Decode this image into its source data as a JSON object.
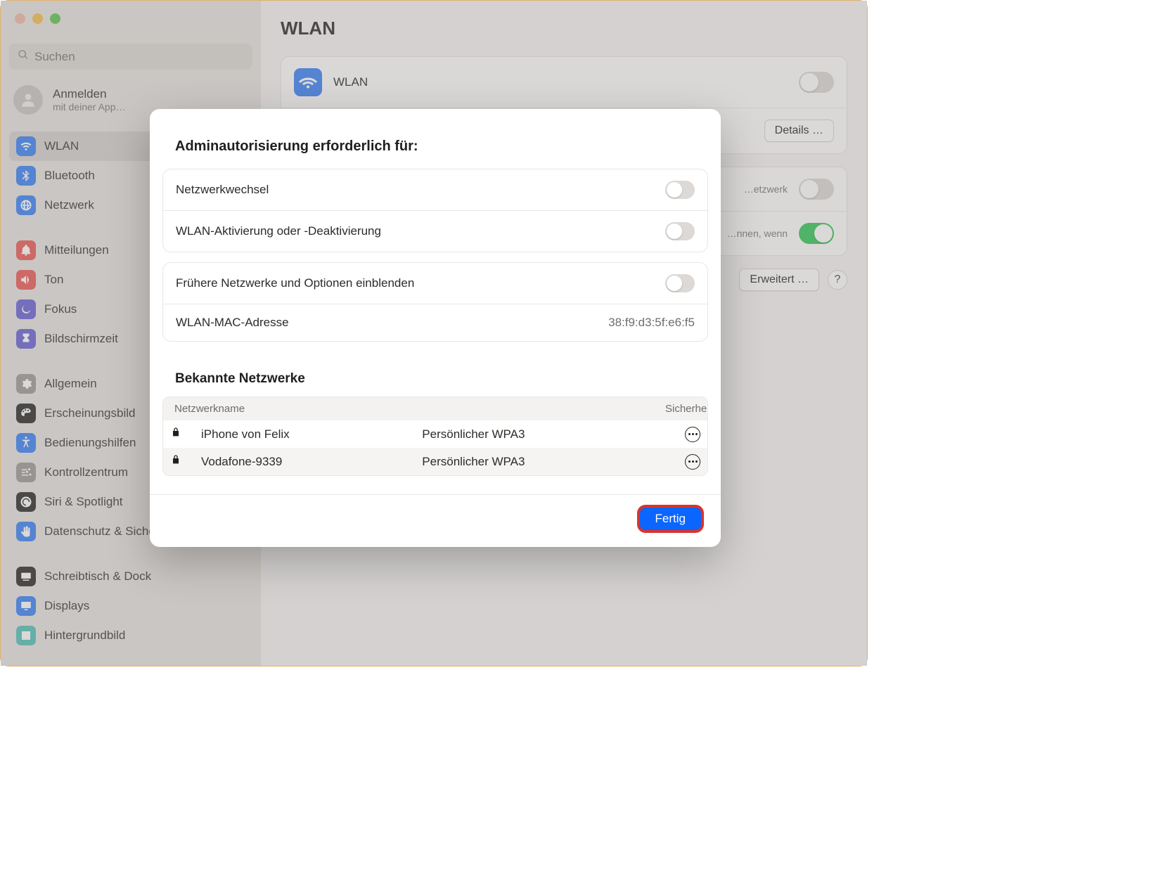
{
  "search": {
    "placeholder": "Suchen"
  },
  "account": {
    "title": "Anmelden",
    "subtitle": "mit deiner App…"
  },
  "sidebar": {
    "items": [
      {
        "label": "WLAN",
        "color": "#3a82f7",
        "icon": "wifi",
        "active": true
      },
      {
        "label": "Bluetooth",
        "color": "#3a82f7",
        "icon": "bluetooth"
      },
      {
        "label": "Netzwerk",
        "color": "#3a82f7",
        "icon": "globe"
      },
      {
        "gap": true
      },
      {
        "label": "Mitteilungen",
        "color": "#ec5b57",
        "icon": "bell"
      },
      {
        "label": "Ton",
        "color": "#ec5b57",
        "icon": "sound"
      },
      {
        "label": "Fokus",
        "color": "#6a62d6",
        "icon": "moon"
      },
      {
        "label": "Bildschirmzeit",
        "color": "#6a62d6",
        "icon": "hourglass"
      },
      {
        "gap": true
      },
      {
        "label": "Allgemein",
        "color": "#9c9a97",
        "icon": "gear"
      },
      {
        "label": "Erscheinungsbild",
        "color": "#2b2b2a",
        "icon": "appearance"
      },
      {
        "label": "Bedienungshilfen",
        "color": "#3a82f7",
        "icon": "accessibility"
      },
      {
        "label": "Kontrollzentrum",
        "color": "#9c9a97",
        "icon": "sliders"
      },
      {
        "label": "Siri & Spotlight",
        "color": "#2b2b2a",
        "icon": "siri"
      },
      {
        "label": "Datenschutz & Sicherheit",
        "color": "#3a82f7",
        "icon": "hand"
      },
      {
        "gap": true
      },
      {
        "label": "Schreibtisch & Dock",
        "color": "#2b2b2a",
        "icon": "dock"
      },
      {
        "label": "Displays",
        "color": "#3a82f7",
        "icon": "display"
      },
      {
        "label": "Hintergrundbild",
        "color": "#55c1b8",
        "icon": "wallpaper"
      }
    ]
  },
  "main": {
    "title": "WLAN",
    "wlan_label": "WLAN",
    "details_button": "Details …",
    "network_hint": "…etzwerk",
    "notify_hint": "…nnen, wenn",
    "advanced_button": "Erweitert …",
    "help": "?"
  },
  "modal": {
    "heading": "Adminautorisierung erforderlich für:",
    "rows": {
      "network_change": "Netzwerkwechsel",
      "wlan_toggle": "WLAN-Aktivierung oder -Deaktivierung",
      "show_prev": "Frühere Netzwerke und Optionen einblenden",
      "mac_label": "WLAN-MAC-Adresse",
      "mac_value": "38:f9:d3:5f:e6:f5"
    },
    "known_heading": "Bekannte Netzwerke",
    "columns": {
      "name": "Netzwerkname",
      "security": "Sicherheitstyp"
    },
    "networks": [
      {
        "name": "iPhone von Felix",
        "security": "Persönlicher WPA3"
      },
      {
        "name": "Vodafone-9339",
        "security": "Persönlicher WPA3"
      }
    ],
    "done": "Fertig"
  }
}
